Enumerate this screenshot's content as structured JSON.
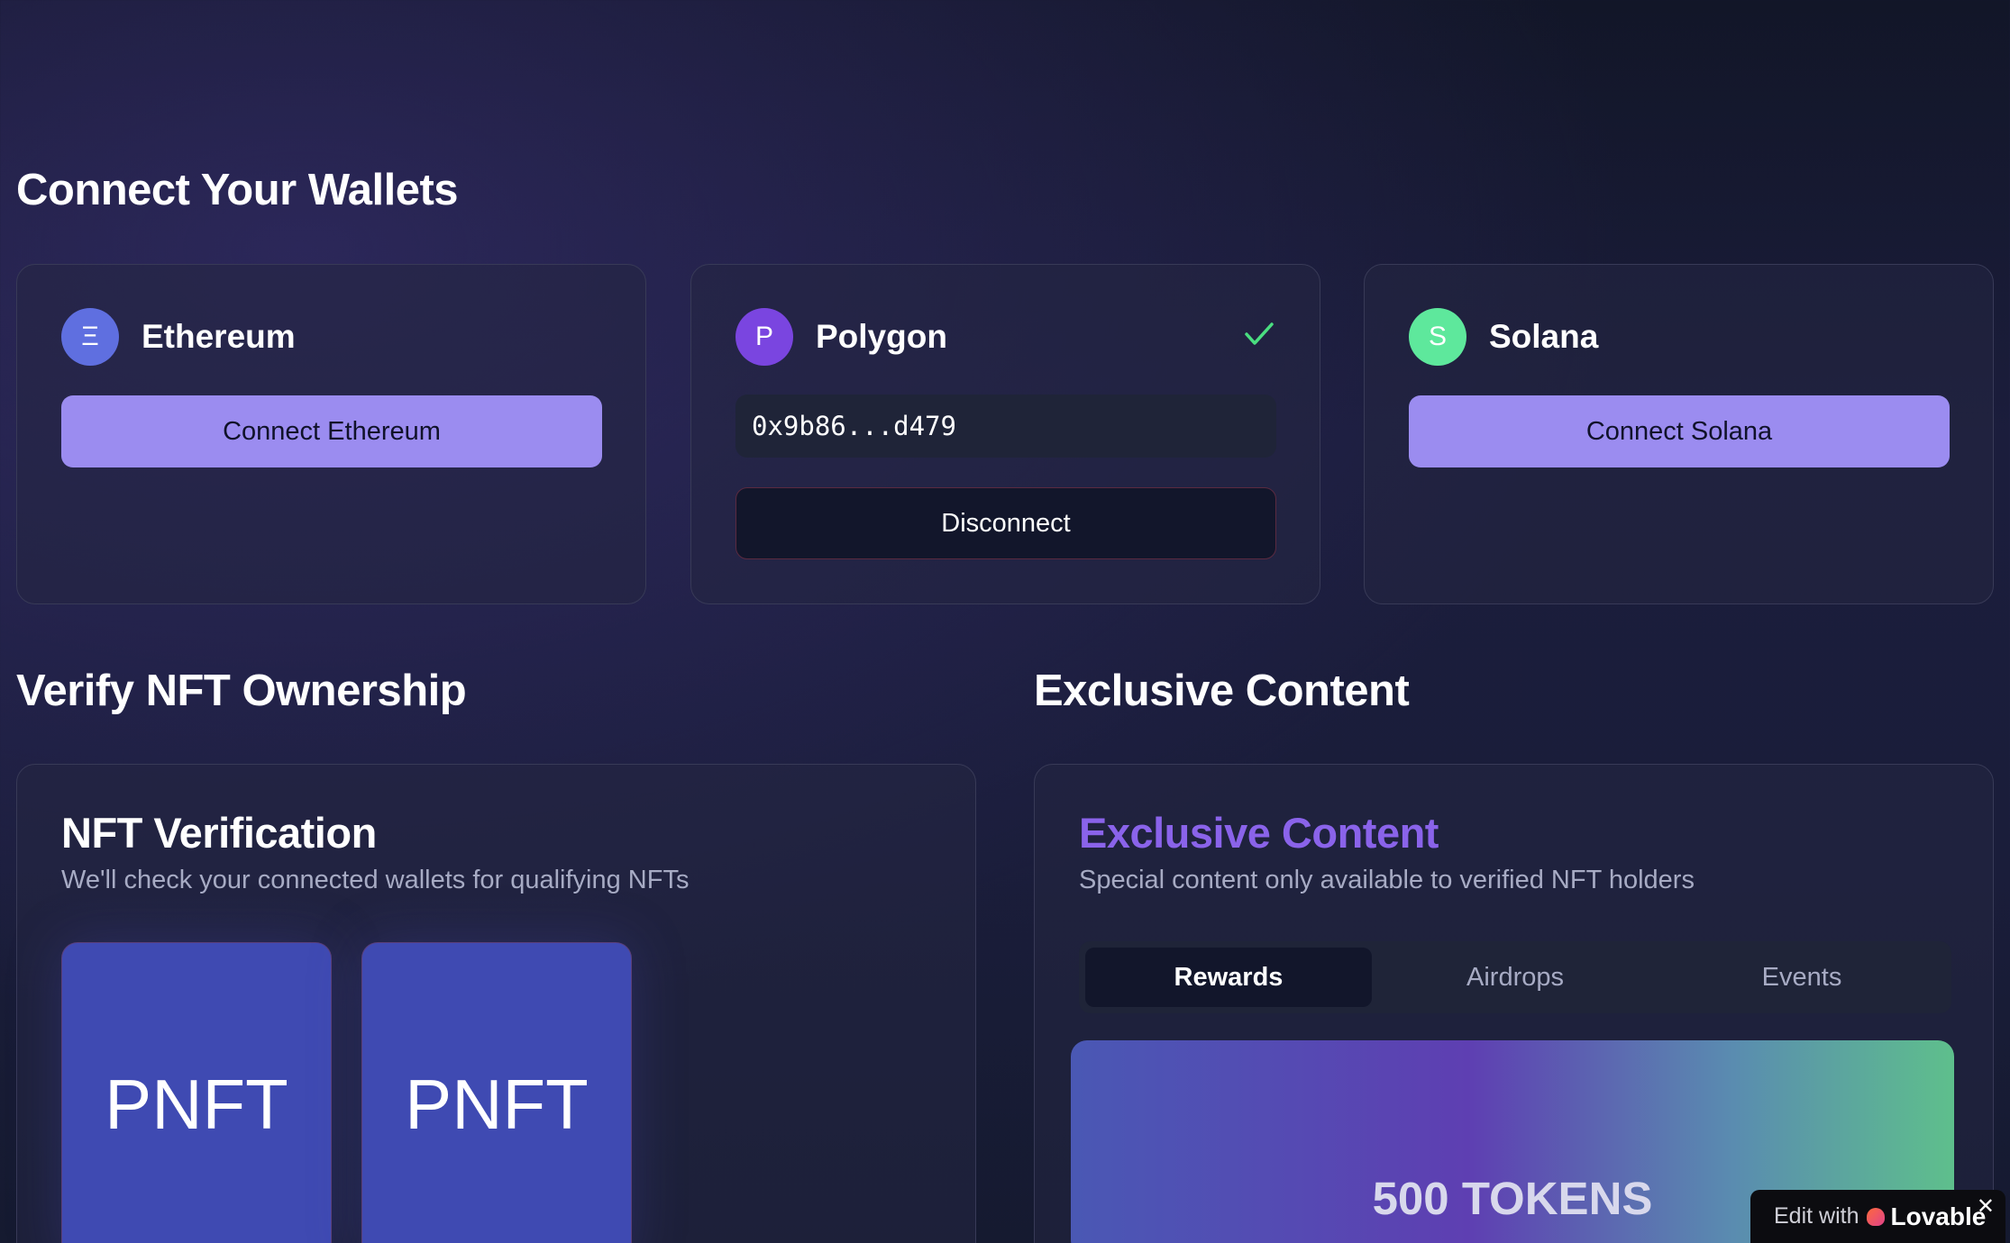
{
  "sections": {
    "wallets_title": "Connect Your Wallets",
    "verify_title": "Verify NFT Ownership",
    "exclusive_title": "Exclusive Content"
  },
  "wallets": [
    {
      "name": "Ethereum",
      "symbol": "Ξ",
      "color": "#5f6fe0",
      "button": "Connect Ethereum"
    },
    {
      "name": "Polygon",
      "symbol": "P",
      "color": "#7a45e0",
      "address": "0x9b86...d479",
      "button": "Disconnect",
      "connected": true
    },
    {
      "name": "Solana",
      "symbol": "S",
      "color": "#5ee89c",
      "button": "Connect Solana"
    }
  ],
  "verification": {
    "title": "NFT Verification",
    "subtitle": "We'll check your connected wallets for qualifying NFTs",
    "nfts": [
      "PNFT",
      "PNFT"
    ]
  },
  "exclusive": {
    "title": "Exclusive Content",
    "subtitle": "Special content only available to verified NFT holders",
    "tabs": [
      "Rewards",
      "Airdrops",
      "Events"
    ],
    "active_tab": "Rewards",
    "banner": "500 TOKENS",
    "title_color": "#8a63ea"
  },
  "badge": {
    "prefix": "Edit with",
    "brand": "Lovable",
    "close": "✕"
  }
}
